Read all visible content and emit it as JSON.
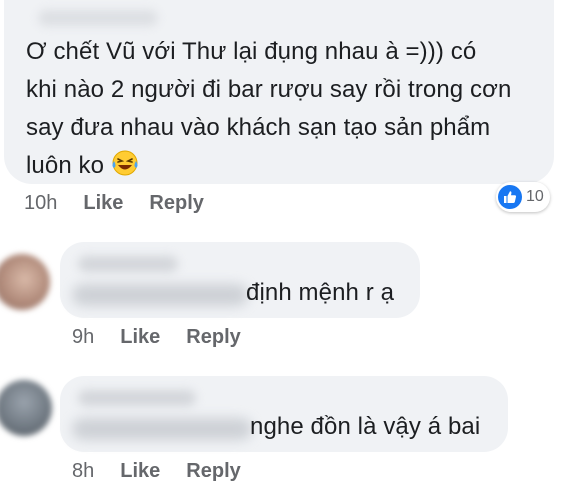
{
  "comments": [
    {
      "text_lines": [
        "Ơ chết Vũ với Thư lại đụng nhau à =))) có",
        "khi nào 2 người đi bar rượu say rồi trong cơn",
        "say đưa nhau vào khách sạn tạo sản phẩm",
        "luôn ko"
      ],
      "emoji_icon": "laughing-tears-emoji",
      "time": "10h",
      "like_label": "Like",
      "reply_label": "Reply",
      "reaction_icon": "thumbs-up-icon",
      "reaction_count": "10"
    },
    {
      "text_visible": "định mệnh r ạ",
      "time": "9h",
      "like_label": "Like",
      "reply_label": "Reply"
    },
    {
      "text_visible": "nghe đồn là vậy á bai",
      "time": "8h",
      "like_label": "Like",
      "reply_label": "Reply"
    }
  ],
  "colors": {
    "bubble": "#f0f2f5",
    "meta_text": "#65676b",
    "like_blue": "#1877f2"
  }
}
